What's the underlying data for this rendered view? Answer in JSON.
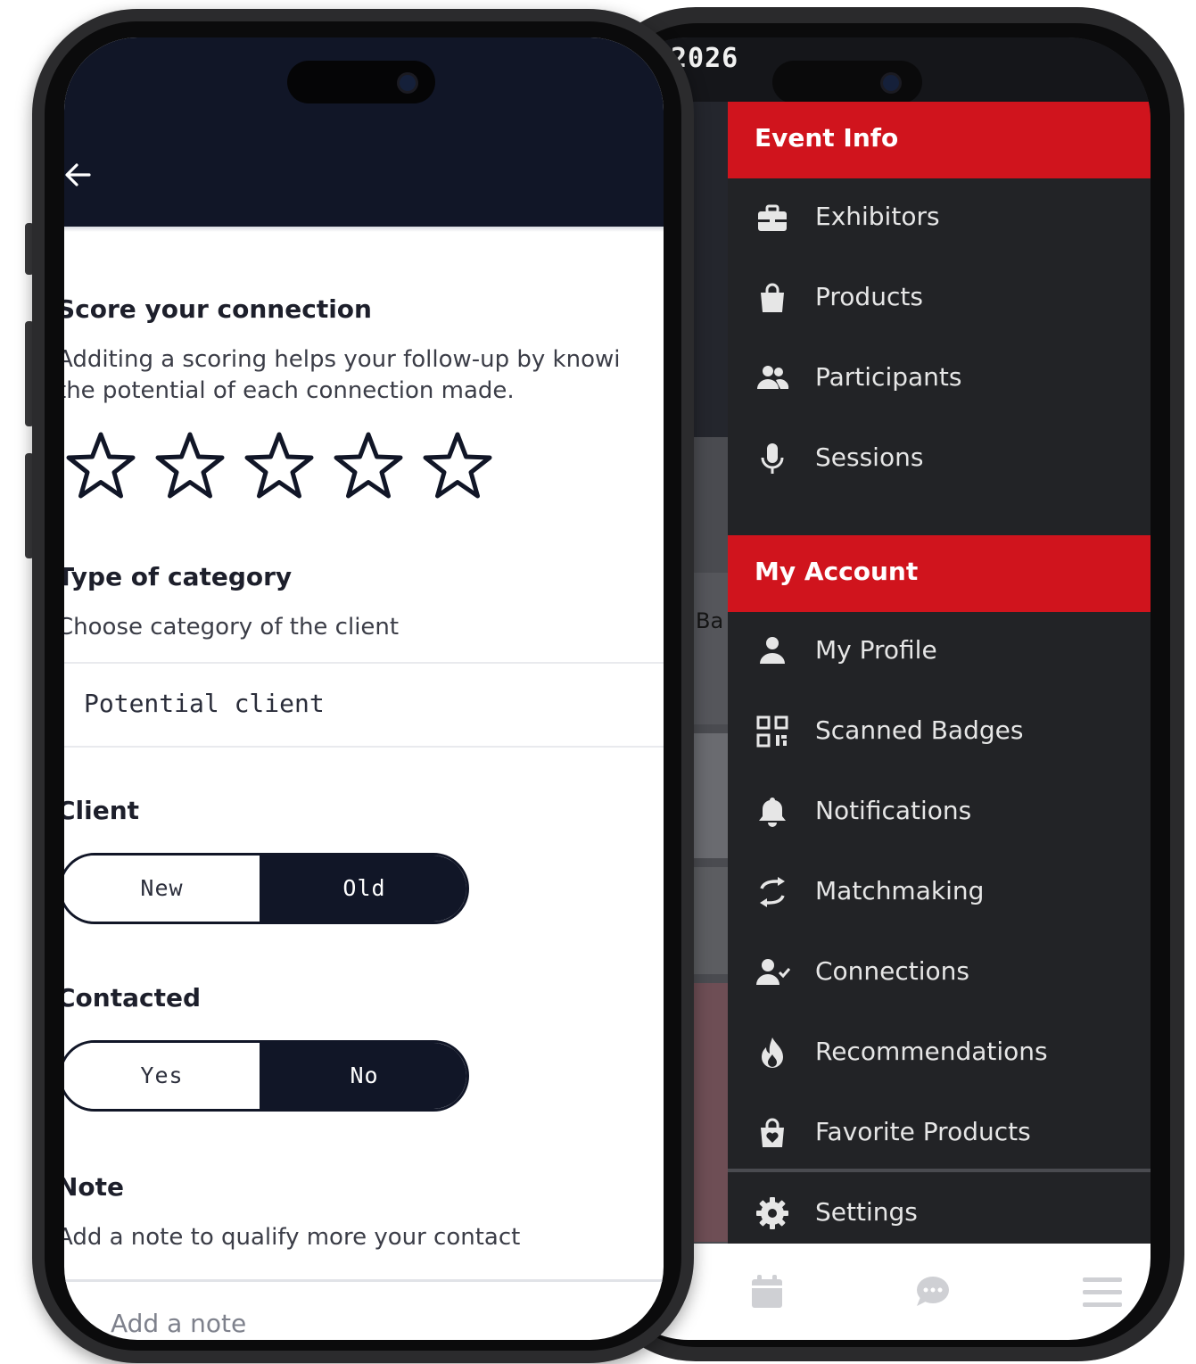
{
  "back_phone": {
    "status_year": "2026",
    "background_peek_text": "Ba",
    "menu": {
      "sections": [
        {
          "header": "Event Info",
          "items": [
            {
              "label": "Exhibitors",
              "icon": "briefcase-icon"
            },
            {
              "label": "Products",
              "icon": "shopping-bag-icon"
            },
            {
              "label": "Participants",
              "icon": "users-icon"
            },
            {
              "label": "Sessions",
              "icon": "microphone-icon"
            }
          ]
        },
        {
          "header": "My Account",
          "items": [
            {
              "label": "My Profile",
              "icon": "user-icon"
            },
            {
              "label": "Scanned Badges",
              "icon": "qr-code-icon"
            },
            {
              "label": "Notifications",
              "icon": "bell-icon"
            },
            {
              "label": "Matchmaking",
              "icon": "swap-arrows-icon"
            },
            {
              "label": "Connections",
              "icon": "user-check-icon"
            },
            {
              "label": "Recommendations",
              "icon": "flame-icon"
            },
            {
              "label": "Favorite Products",
              "icon": "favorite-bag-icon"
            }
          ]
        }
      ],
      "settings_label": "Settings"
    },
    "tabbar": [
      "calendar-icon",
      "chat-icon",
      "hamburger-menu-icon"
    ]
  },
  "front_phone": {
    "score": {
      "title": "Score your connection",
      "description_line1": "Additing a scoring helps your follow-up by knowi",
      "description_line2": "the potential of each connection made.",
      "rating": 0,
      "max_rating": 5
    },
    "category": {
      "title": "Type of category",
      "description": "Choose category of the client",
      "selected_value": "Potential client"
    },
    "client": {
      "title": "Client",
      "options": [
        "New",
        "Old"
      ],
      "selected": "Old"
    },
    "contacted": {
      "title": "Contacted",
      "options": [
        "Yes",
        "No"
      ],
      "selected": "No"
    },
    "note": {
      "title": "Note",
      "description": "Add a note to qualify more your contact",
      "placeholder": "Add a note"
    }
  },
  "colors": {
    "navy": "#111627",
    "accent_red": "#d0141d",
    "menu_bg": "#222326",
    "text_dark": "#1d1f2b"
  }
}
